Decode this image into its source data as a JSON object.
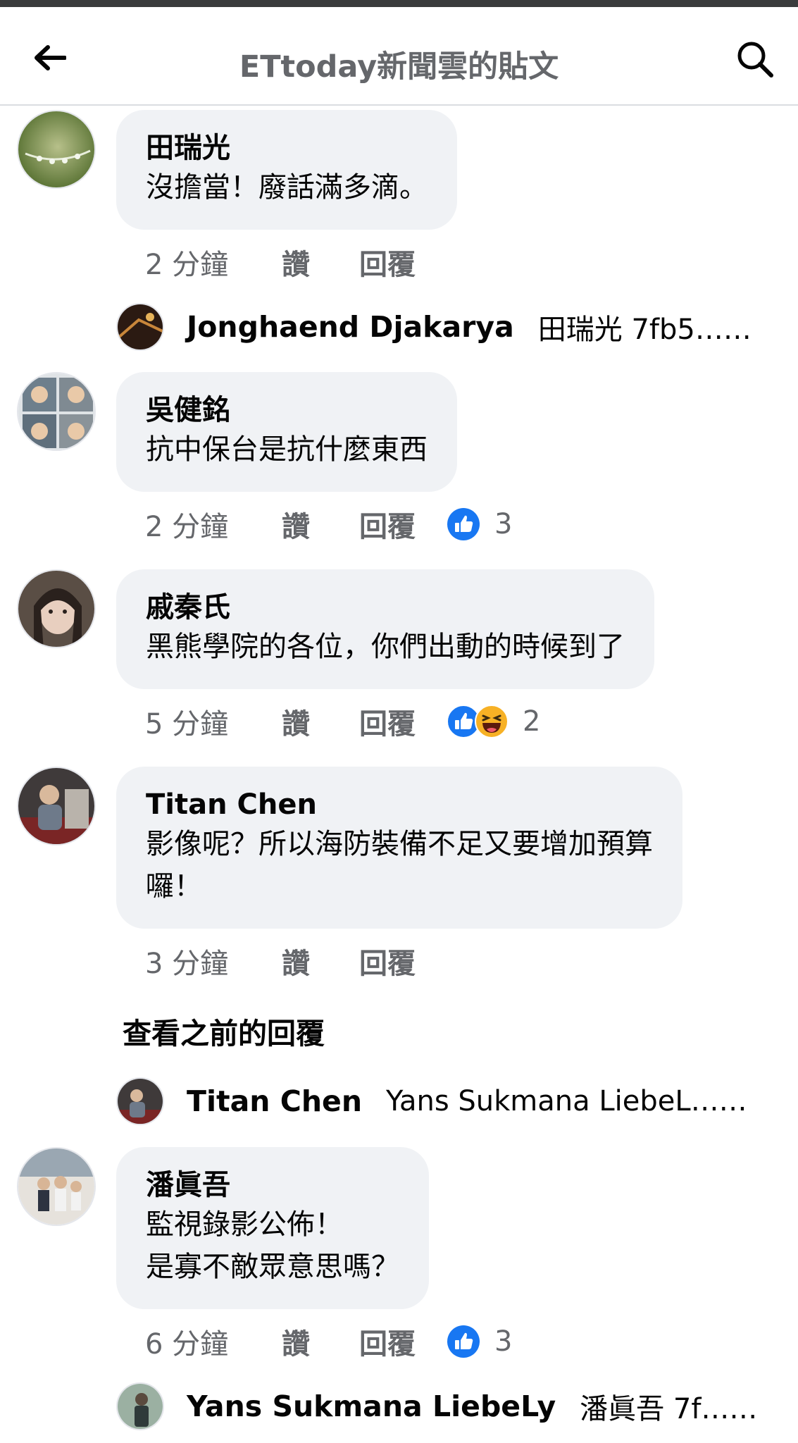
{
  "header": {
    "title": "ETtoday新聞雲的貼文"
  },
  "comments": [
    {
      "author": "田瑞光",
      "lines": [
        "沒擔當！廢話滿多滴。"
      ],
      "time": "2 分鐘",
      "like_label": "讚",
      "reply_label": "回覆",
      "reactions": [],
      "reaction_count": "",
      "reply_preview": {
        "name": "Jonghaend Djakarya",
        "text": "田瑞光  7fb5……"
      }
    },
    {
      "author": "吳健銘",
      "lines": [
        "抗中保台是抗什麼東西"
      ],
      "time": "2 分鐘",
      "like_label": "讚",
      "reply_label": "回覆",
      "reactions": [
        "like-icon"
      ],
      "reaction_count": "3"
    },
    {
      "author": "戚秦氏",
      "lines": [
        "黑熊學院的各位，你們出動的時候到了"
      ],
      "time": "5 分鐘",
      "like_label": "讚",
      "reply_label": "回覆",
      "reactions": [
        "like-icon",
        "haha-icon"
      ],
      "reaction_count": "2"
    },
    {
      "author": "Titan Chen",
      "lines": [
        "影像呢？所以海防裝備不足又要增加預算",
        "囉！"
      ],
      "time": "3 分鐘",
      "like_label": "讚",
      "reply_label": "回覆",
      "reactions": [],
      "reaction_count": "",
      "previous_replies_label": "查看之前的回覆",
      "reply_preview": {
        "name": "Titan Chen",
        "text": "Yans Sukmana LiebeL……"
      }
    },
    {
      "author": "潘眞吾",
      "lines": [
        "監視錄影公佈！",
        "是寡不敵眾意思嗎？"
      ],
      "time": "6 分鐘",
      "like_label": "讚",
      "reply_label": "回覆",
      "reactions": [
        "like-icon"
      ],
      "reaction_count": "3",
      "reply_preview": {
        "name": "Yans Sukmana LiebeLy",
        "text": "潘眞吾  7f……"
      }
    }
  ],
  "colors": {
    "bubble": "#f0f2f5",
    "meta_text": "#65676b",
    "like_blue": "#1877f2",
    "haha_yellow": "#f7b125"
  }
}
